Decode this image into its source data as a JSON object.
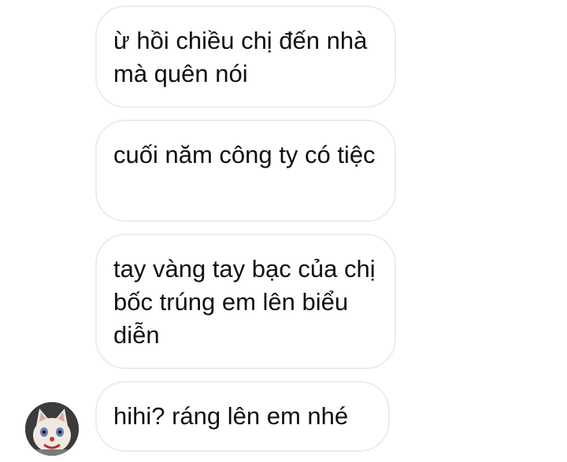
{
  "messages": [
    {
      "text": "ừ hồi chiều chị đến nhà mà quên nói"
    },
    {
      "text": "cuối năm công ty có tiệc"
    },
    {
      "text": "tay vàng tay bạc của chị bốc trúng em lên biểu diễn"
    },
    {
      "text": "hihi? ráng lên em nhé"
    }
  ],
  "avatar": {
    "icon": "cat-clown-avatar"
  },
  "colors": {
    "bubble_border": "#ececec",
    "text": "#111111",
    "background": "#ffffff"
  }
}
